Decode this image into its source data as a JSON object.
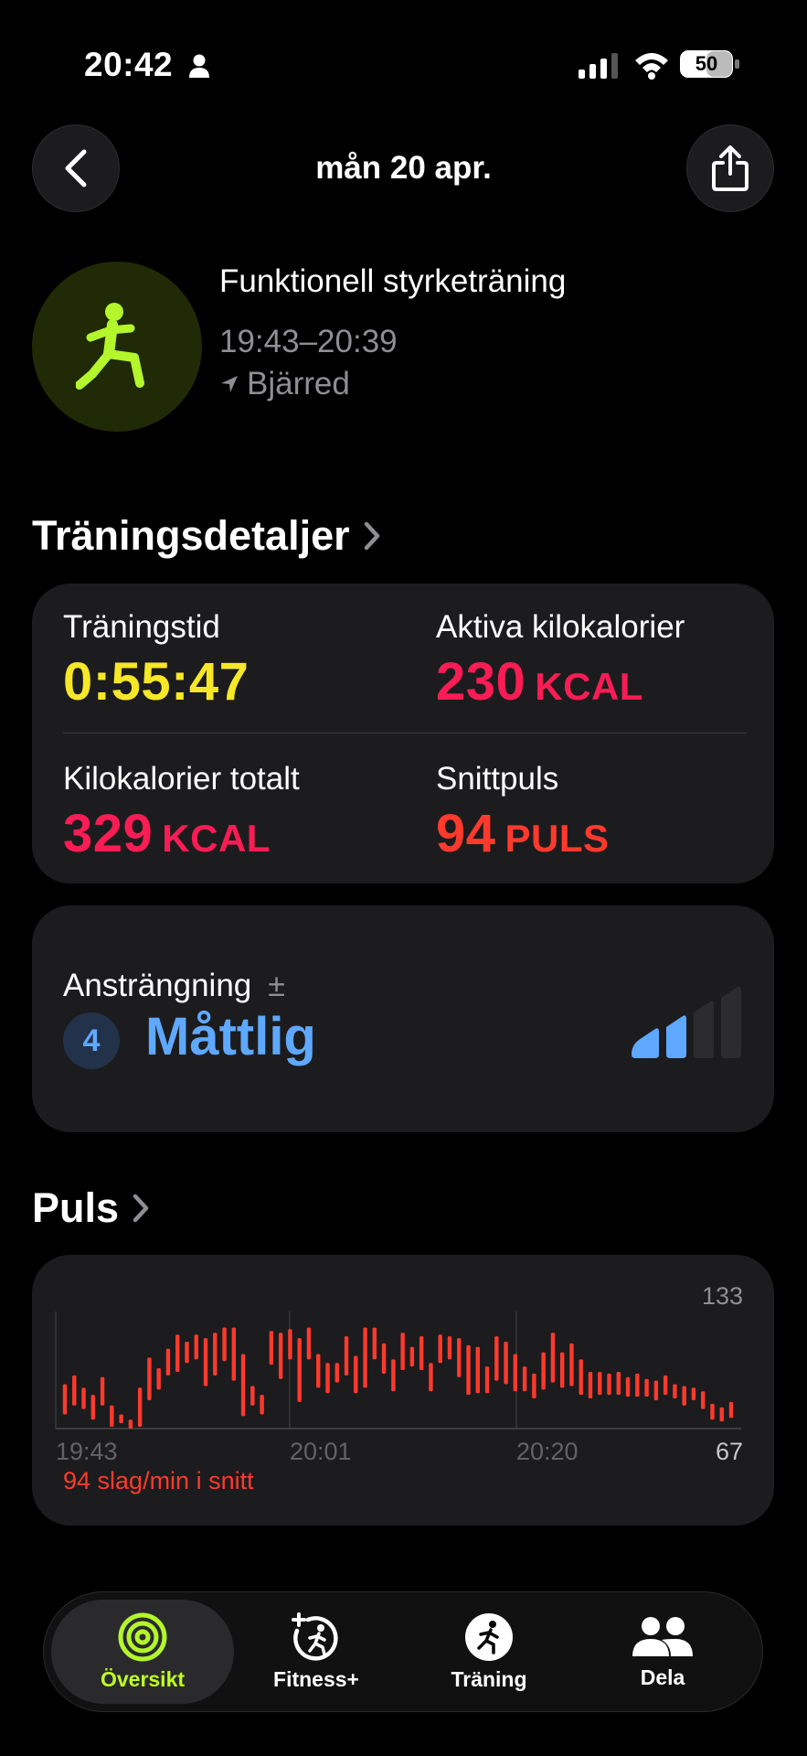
{
  "status": {
    "time": "20:42",
    "battery": "50"
  },
  "nav": {
    "title": "mån 20 apr."
  },
  "workout": {
    "name": "Funktionell styrketräning",
    "time_range": "19:43–20:39",
    "location": "Bjärred"
  },
  "details": {
    "section_title": "Träningsdetaljer",
    "items": [
      {
        "label": "Träningstid",
        "value": "0:55:47",
        "unit": "",
        "color": "#f6e728"
      },
      {
        "label": "Aktiva kilokalorier",
        "value": "230",
        "unit": "KCAL",
        "color": "#fa1c55"
      },
      {
        "label": "Kilokalorier totalt",
        "value": "329",
        "unit": "KCAL",
        "color": "#fa1c55"
      },
      {
        "label": "Snittpuls",
        "value": "94",
        "unit": "PULS",
        "color": "#ff3a2d"
      }
    ]
  },
  "effort": {
    "label": "Ansträngning",
    "adjust_symbol": "±",
    "level": "4",
    "level_text": "Måttlig",
    "filled_bars": 2,
    "total_bars": 4
  },
  "heart": {
    "section_title": "Puls",
    "avg_text": "94 slag/min i snitt",
    "chart_data": {
      "type": "bar",
      "ymax_label": "133",
      "ymin_label": "67",
      "ylim": [
        67,
        133
      ],
      "x_ticks": [
        "19:43",
        "20:01",
        "20:20"
      ],
      "color": "#ff3a2d",
      "ranges": [
        [
          75,
          92
        ],
        [
          80,
          97
        ],
        [
          78,
          90
        ],
        [
          72,
          86
        ],
        [
          80,
          96
        ],
        [
          68,
          80
        ],
        [
          70,
          75
        ],
        [
          67,
          72
        ],
        [
          68,
          90
        ],
        [
          83,
          107
        ],
        [
          89,
          101
        ],
        [
          97,
          112
        ],
        [
          99,
          120
        ],
        [
          104,
          116
        ],
        [
          106,
          120
        ],
        [
          91,
          118
        ],
        [
          97,
          121
        ],
        [
          105,
          124
        ],
        [
          94,
          124
        ],
        [
          74,
          109
        ],
        [
          80,
          91
        ],
        [
          75,
          86
        ],
        [
          103,
          122
        ],
        [
          95,
          121
        ],
        [
          106,
          123
        ],
        [
          82,
          118
        ],
        [
          106,
          124
        ],
        [
          90,
          109
        ],
        [
          87,
          104
        ],
        [
          93,
          104
        ],
        [
          97,
          119
        ],
        [
          87,
          108
        ],
        [
          90,
          124
        ],
        [
          106,
          124
        ],
        [
          98,
          115
        ],
        [
          88,
          106
        ],
        [
          100,
          121
        ],
        [
          102,
          113
        ],
        [
          100,
          119
        ],
        [
          88,
          104
        ],
        [
          104,
          120
        ],
        [
          106,
          119
        ],
        [
          96,
          118
        ],
        [
          86,
          114
        ],
        [
          87,
          113
        ],
        [
          87,
          102
        ],
        [
          94,
          119
        ],
        [
          92,
          116
        ],
        [
          88,
          109
        ],
        [
          88,
          102
        ],
        [
          84,
          98
        ],
        [
          89,
          110
        ],
        [
          93,
          121
        ],
        [
          90,
          110
        ],
        [
          91,
          115
        ],
        [
          86,
          106
        ],
        [
          84,
          99
        ],
        [
          86,
          99
        ],
        [
          86,
          98
        ],
        [
          86,
          99
        ],
        [
          85,
          96
        ],
        [
          85,
          98
        ],
        [
          85,
          95
        ],
        [
          83,
          94
        ],
        [
          86,
          97
        ],
        [
          84,
          92
        ],
        [
          80,
          91
        ],
        [
          83,
          90
        ],
        [
          78,
          88
        ],
        [
          72,
          81
        ],
        [
          71,
          79
        ],
        [
          73,
          82
        ]
      ]
    }
  },
  "tabs": [
    {
      "label": "Översikt",
      "icon": "activity-rings-icon",
      "selected": true
    },
    {
      "label": "Fitness+",
      "icon": "fitness-plus-icon",
      "selected": false
    },
    {
      "label": "Träning",
      "icon": "running-figure-icon",
      "selected": false
    },
    {
      "label": "Dela",
      "icon": "people-icon",
      "selected": false
    }
  ]
}
